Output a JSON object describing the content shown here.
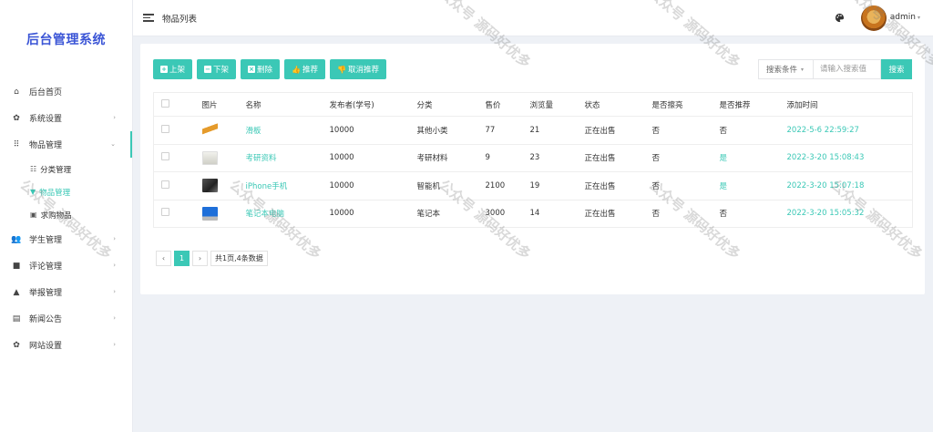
{
  "sidebar": {
    "brand": "后台管理系统",
    "items": [
      {
        "label": "后台首页",
        "icon": "home-icon"
      },
      {
        "label": "系统设置",
        "icon": "gear-icon",
        "chevron": "›"
      },
      {
        "label": "物品管理",
        "icon": "grid-icon",
        "chevron": "⌄"
      },
      {
        "label": "学生管理",
        "icon": "users-icon",
        "chevron": "›"
      },
      {
        "label": "评论管理",
        "icon": "comment-icon",
        "chevron": "›"
      },
      {
        "label": "举报管理",
        "icon": "warning-icon",
        "chevron": "›"
      },
      {
        "label": "新闻公告",
        "icon": "newspaper-icon",
        "chevron": "›"
      },
      {
        "label": "网站设置",
        "icon": "gear-icon",
        "chevron": "›"
      }
    ],
    "sub_items": [
      {
        "label": "分类管理",
        "icon": "list-icon"
      },
      {
        "label": "物品管理",
        "icon": "filter-icon"
      },
      {
        "label": "求购物品",
        "icon": "id-card-icon"
      }
    ]
  },
  "header": {
    "title": "物品列表",
    "user": "admin",
    "caret": "▾"
  },
  "toolbar": {
    "list_on": "上架",
    "list_off": "下架",
    "delete": "删除",
    "recommend": "推荐",
    "cancel_recommend": "取消推荐"
  },
  "search": {
    "condition": "搜索条件",
    "placeholder": "请输入搜索值",
    "button": "搜索"
  },
  "table": {
    "headers": [
      "",
      "图片",
      "名称",
      "发布者(学号)",
      "分类",
      "售价",
      "浏览量",
      "状态",
      "是否擦亮",
      "是否推荐",
      "添加时间"
    ],
    "rows": [
      {
        "name": "滑板",
        "thumb": "skateboard",
        "publisher": "10000",
        "category": "其他小类",
        "price": "77",
        "views": "21",
        "status": "正在出售",
        "polished": "否",
        "recommended": "否",
        "added": "2022-5-6 22:59:27"
      },
      {
        "name": "考研资料",
        "thumb": "paper",
        "publisher": "10000",
        "category": "考研材料",
        "price": "9",
        "views": "23",
        "status": "正在出售",
        "polished": "否",
        "recommended": "是",
        "added": "2022-3-20 15:08:43"
      },
      {
        "name": "iPhone手机",
        "thumb": "phone",
        "publisher": "10000",
        "category": "智能机",
        "price": "2100",
        "views": "19",
        "status": "正在出售",
        "polished": "否",
        "recommended": "是",
        "added": "2022-3-20 15:07:18"
      },
      {
        "name": "笔记本电脑",
        "thumb": "laptop",
        "publisher": "10000",
        "category": "笔记本",
        "price": "3000",
        "views": "14",
        "status": "正在出售",
        "polished": "否",
        "recommended": "否",
        "added": "2022-3-20 15:05:32"
      }
    ]
  },
  "pager": {
    "prev": "‹",
    "current": "1",
    "next": "›",
    "info": "共1页,4条数据"
  },
  "watermark": "公众号 源码好优多"
}
